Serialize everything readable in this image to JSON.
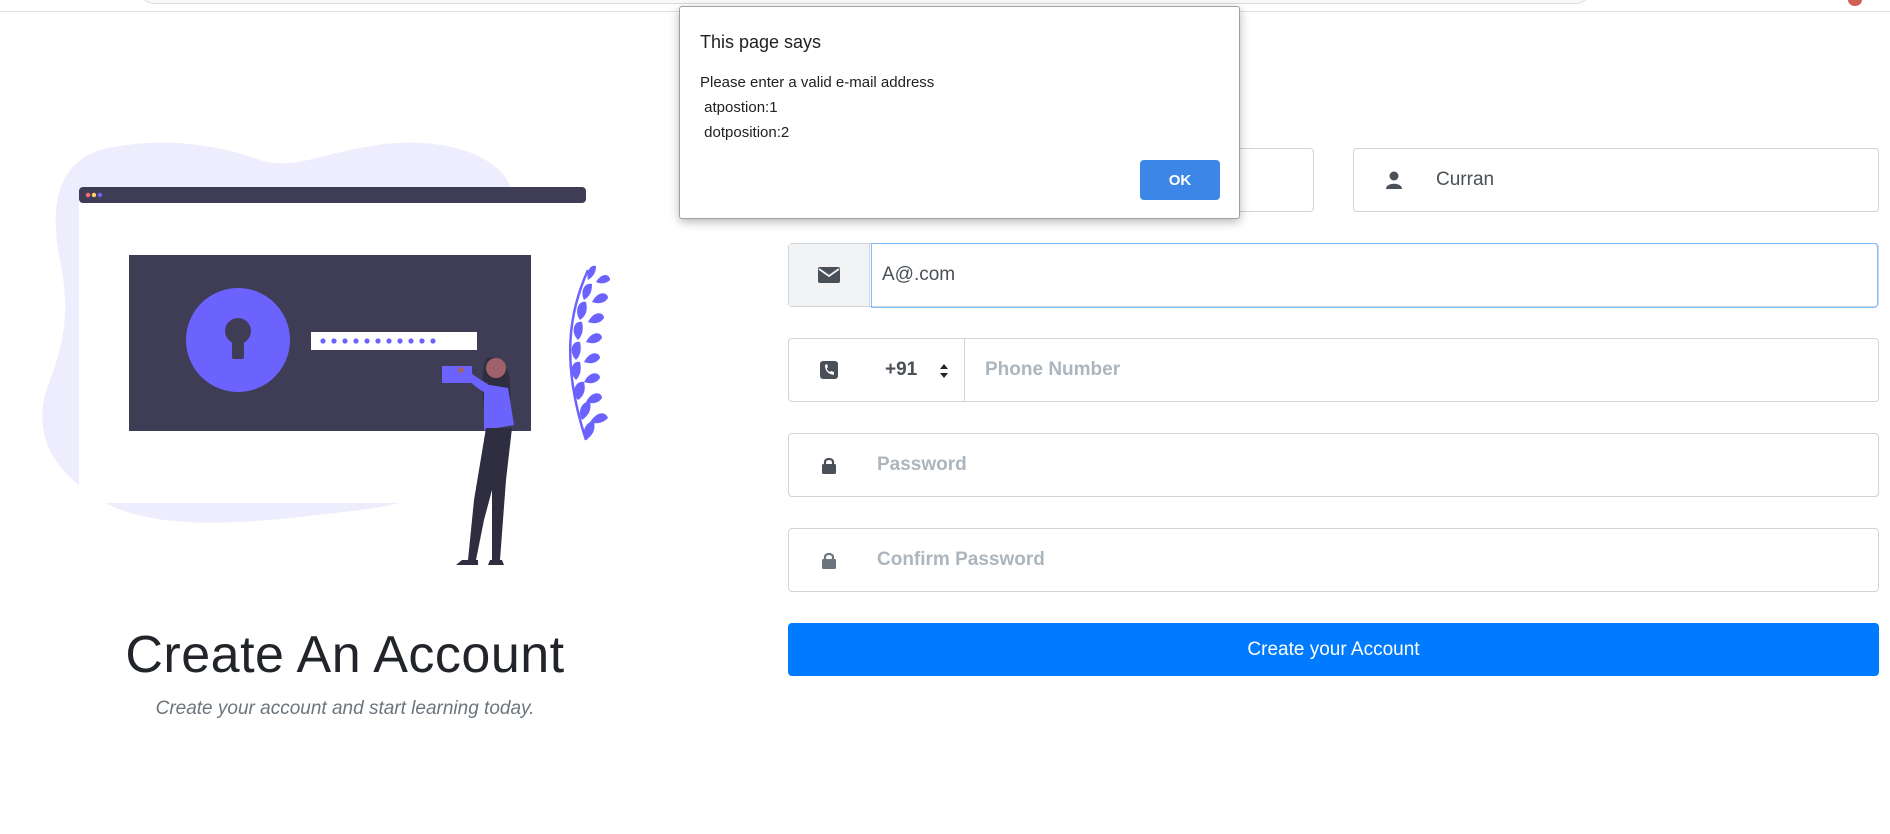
{
  "left_panel": {
    "heading": "Create An Account",
    "subheading": "Create your account and start learning today."
  },
  "form": {
    "first_name": {
      "value": "",
      "placeholder": ""
    },
    "last_name": {
      "value": "Curran",
      "placeholder": ""
    },
    "email": {
      "value": "A@.com",
      "placeholder": ""
    },
    "phone_code": "+91",
    "phone": {
      "value": "",
      "placeholder": "Phone Number"
    },
    "password": {
      "value": "",
      "placeholder": "Password"
    },
    "confirm_password": {
      "value": "",
      "placeholder": "Confirm Password"
    },
    "submit_label": "Create your Account"
  },
  "alert": {
    "title": "This page says",
    "message": "Please enter a valid e-mail address\n atpostion:1\n dotposition:2",
    "ok_label": "OK"
  },
  "icons": {
    "user": "user-icon",
    "email": "envelope-icon",
    "phone": "phone-icon",
    "lock": "lock-icon"
  },
  "colors": {
    "accent": "#007bff",
    "illustration_purple": "#6c63ff",
    "illustration_dark": "#3f3d56",
    "dialog_button": "#3b86e6"
  }
}
